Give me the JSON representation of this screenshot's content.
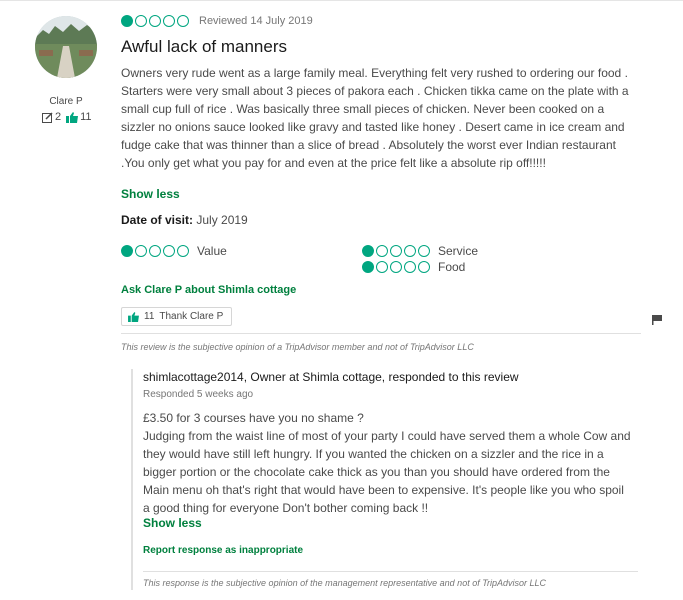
{
  "review": {
    "reviewer_name": "Clare P",
    "contributions": "2",
    "helpful_votes": "11",
    "rating": 1,
    "reviewed_date": "Reviewed 14 July 2019",
    "title": "Awful lack of manners",
    "body": "Owners very rude went as a large family meal. Everything felt very rushed to ordering our food . Starters were very small about 3 pieces of pakora each . Chicken tikka came on the plate with a small cup full of rice . Was basically three small pieces of chicken. Never been cooked on a sizzler no onions sauce looked like gravy and tasted like honey . Desert came in ice cream and fudge cake that was thinner than a slice of bread . Absolutely the worst ever Indian restaurant .You only get what you pay for and even at the price felt like a absolute rip off!!!!!",
    "show_less": "Show less",
    "date_of_visit_label": "Date of visit:",
    "date_of_visit": "July 2019",
    "subratings": [
      {
        "label": "Value",
        "rating": 1
      },
      {
        "label": "Service",
        "rating": 1
      },
      {
        "label": "Food",
        "rating": 1
      }
    ],
    "ask_link": "Ask Clare P about Shimla cottage",
    "thank_count": "11",
    "thank_label": "Thank Clare P",
    "disclaimer": "This review is the subjective opinion of a TripAdvisor member and not of TripAdvisor LLC"
  },
  "response": {
    "responder": "shimlacottage2014, Owner at Shimla cottage, responded to this review",
    "responded_when": "Responded 5 weeks ago",
    "line1": "£3.50 for 3 courses have you no shame ?",
    "line2": "Judging from the waist line of most of your party I could have served them a whole Cow and they would have still left hungry. If you wanted the chicken on a sizzler and the rice in a bigger portion or the chocolate cake thick as you than you should have ordered from the Main menu oh that's right that would have been to expensive. It's people like you who spoil a good thing for everyone Don't bother coming back !!",
    "show_less": "Show less",
    "report_link": "Report response as inappropriate",
    "disclaimer": "This response is the subjective opinion of the management representative and not of TripAdvisor LLC"
  },
  "colors": {
    "accent_green": "#00a680",
    "link_green": "#00803e"
  }
}
